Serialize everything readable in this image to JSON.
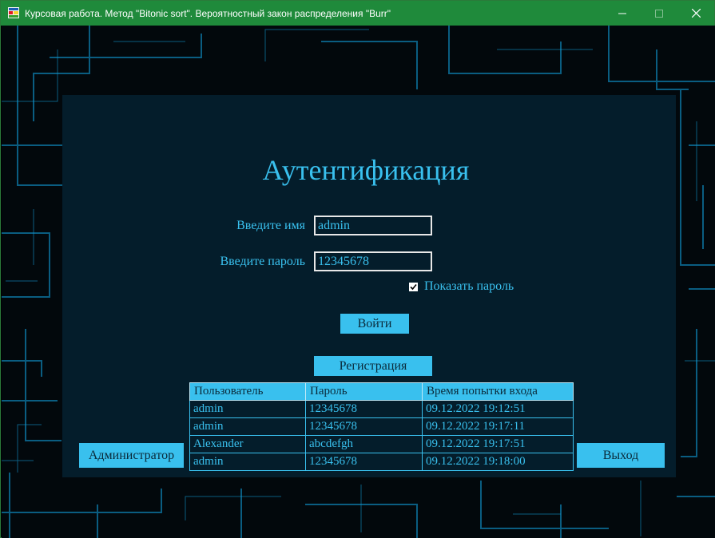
{
  "window": {
    "title": "Курсовая работа. Метод \"Bitonic sort\". Вероятностный закон распределения \"Burr\""
  },
  "form": {
    "heading": "Аутентификация",
    "name_label": "Введите имя",
    "name_value": "admin",
    "password_label": "Введите пароль",
    "password_value": "12345678",
    "show_password_label": "Показать пароль",
    "show_password_checked": true,
    "login_button": "Войти",
    "register_button": "Регистрация",
    "admin_button": "Администратор",
    "exit_button": "Выход"
  },
  "log_table": {
    "headers": [
      "Пользователь",
      "Пароль",
      "Время попытки входа"
    ],
    "rows": [
      [
        "admin",
        "12345678",
        "09.12.2022 19:12:51"
      ],
      [
        "admin",
        "12345678",
        "09.12.2022 19:17:11"
      ],
      [
        "Alexander",
        "abcdefgh",
        "09.12.2022 19:17:51"
      ],
      [
        "admin",
        "12345678",
        "09.12.2022 19:18:00"
      ]
    ]
  },
  "colors": {
    "titlebar": "#1f8a3b",
    "accent": "#39c0ee",
    "panel": "#041d2b",
    "background": "#02080c"
  }
}
